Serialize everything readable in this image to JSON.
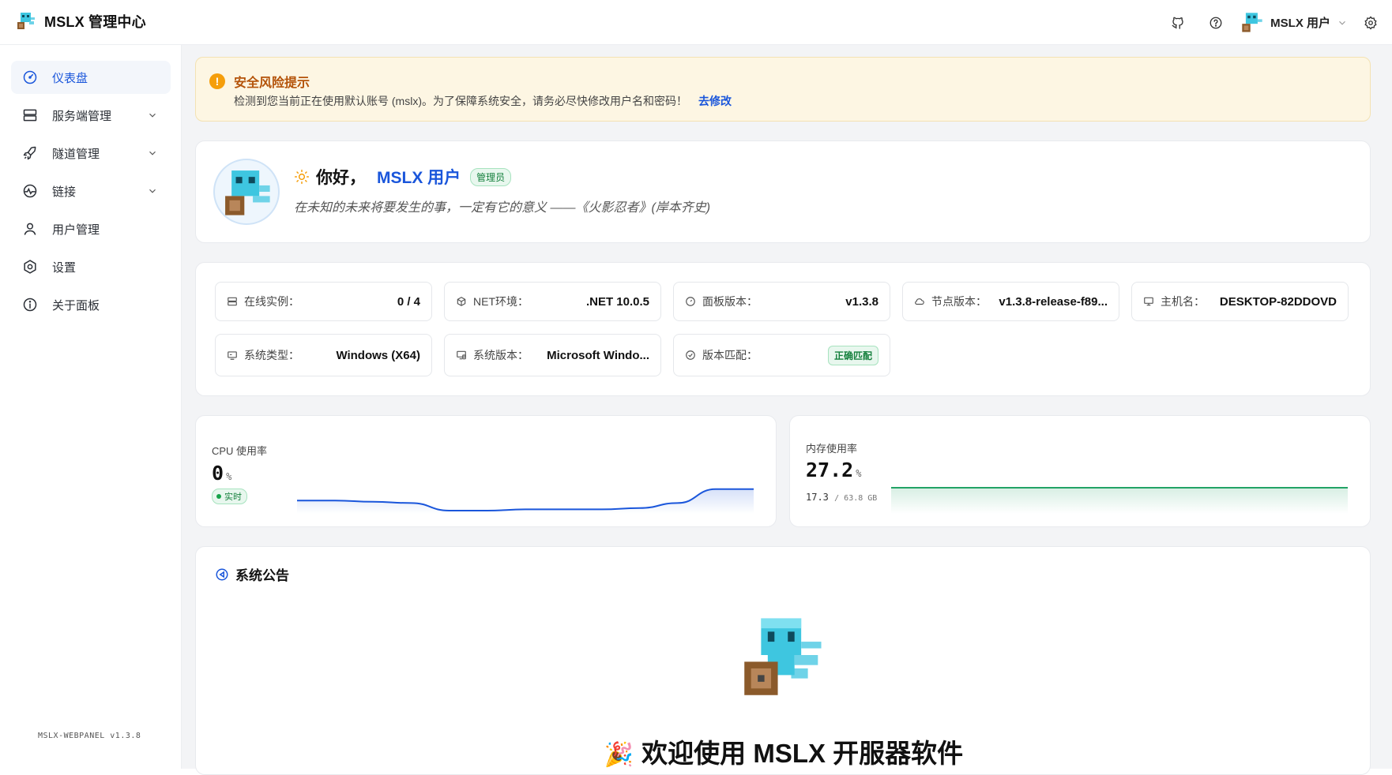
{
  "app": {
    "title": "MSLX 管理中心"
  },
  "header": {
    "icons": [
      "github-icon",
      "help-icon",
      "settings-icon"
    ],
    "user_name": "MSLX 用户"
  },
  "sidebar": {
    "items": [
      {
        "label": "仪表盘",
        "icon": "dashboard-icon",
        "active": true,
        "expandable": false
      },
      {
        "label": "服务端管理",
        "icon": "server-icon",
        "active": false,
        "expandable": true
      },
      {
        "label": "隧道管理",
        "icon": "rocket-icon",
        "active": false,
        "expandable": true
      },
      {
        "label": "链接",
        "icon": "link-icon",
        "active": false,
        "expandable": true
      },
      {
        "label": "用户管理",
        "icon": "user-icon",
        "active": false,
        "expandable": false
      },
      {
        "label": "设置",
        "icon": "settings-icon",
        "active": false,
        "expandable": false
      },
      {
        "label": "关于面板",
        "icon": "info-icon",
        "active": false,
        "expandable": false
      }
    ],
    "footer": "MSLX-WEBPANEL v1.3.8"
  },
  "alert": {
    "title": "安全风险提示",
    "text": "检测到您当前正在使用默认账号 (mslx)。为了保障系统安全，请务必尽快修改用户名和密码！",
    "link": "去修改"
  },
  "welcome": {
    "greeting": "你好，",
    "name": "MSLX 用户",
    "role_badge": "管理员",
    "quote": "在未知的未来将要发生的事，一定有它的意义 ——《火影忍者》(岸本齐史)"
  },
  "info": {
    "items": [
      {
        "label": "在线实例：",
        "value": "0 / 4",
        "icon": "server-icon"
      },
      {
        "label": "NET环境：",
        "value": ".NET 10.0.5",
        "icon": "cube-icon"
      },
      {
        "label": "面板版本：",
        "value": "v1.3.8",
        "icon": "gauge-icon"
      },
      {
        "label": "节点版本：",
        "value": "v1.3.8-release-f89...",
        "icon": "cloud-icon"
      },
      {
        "label": "主机名：",
        "value": "DESKTOP-82DDOVD",
        "icon": "monitor-icon"
      },
      {
        "label": "系统类型：",
        "value": "Windows (X64)",
        "icon": "chip-icon"
      },
      {
        "label": "系统版本：",
        "value": "Microsoft Windo...",
        "icon": "desktop-icon"
      },
      {
        "label": "版本匹配：",
        "badge": "正确匹配",
        "icon": "check-circle-icon"
      }
    ]
  },
  "cpu": {
    "label": "CPU 使用率",
    "value": "0",
    "unit": "%",
    "badge": "实时",
    "color": "#1a56db",
    "series": [
      0.08,
      0.08,
      0.07,
      0.06,
      0.0,
      0.0,
      0.01,
      0.01,
      0.01,
      0.02,
      0.06,
      0.17,
      0.17
    ]
  },
  "memory": {
    "label": "内存使用率",
    "value": "27.2",
    "unit": "%",
    "used": "17.3",
    "total": "/ 63.8 GB",
    "color": "#22a366",
    "series": [
      27.2,
      27.2,
      27.2,
      27.2,
      27.2,
      27.2,
      27.2,
      27.2,
      27.2,
      27.2,
      27.2,
      27.2,
      27.2
    ]
  },
  "notice": {
    "title": "系统公告",
    "welcome_emoji": "🎉",
    "welcome_text": "欢迎使用 MSLX 开服器软件"
  }
}
